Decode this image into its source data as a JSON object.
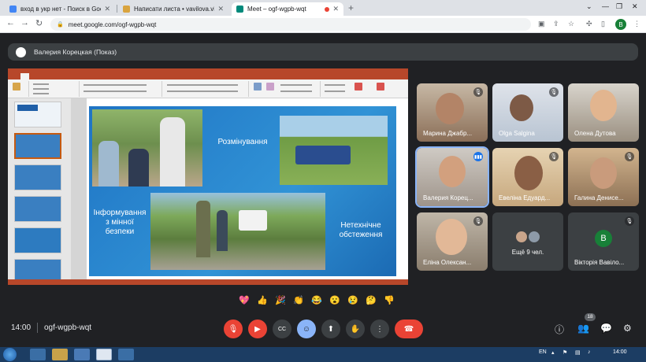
{
  "browser": {
    "tabs": [
      {
        "label": "вход в укр нет - Поиск в Google",
        "favicon_color": "#4285f4"
      },
      {
        "label": "Написати листа • vavilova.viccs...",
        "favicon_color": "#d9a43f"
      },
      {
        "label": "Meet – ogf-wgpb-wqt",
        "favicon_color": "#00897b"
      }
    ],
    "new_tab": "+",
    "url": "meet.google.com/ogf-wgpb-wqt",
    "profile_initial": "В"
  },
  "presenter": {
    "label": "Валерия Корецкая (Показ)"
  },
  "slide": {
    "texts": [
      "Розмінування",
      "Інформування з мінної безпеки",
      "Нетехнічне обстеження"
    ]
  },
  "participants": [
    {
      "name": "Марина Джабр...",
      "state": "muted"
    },
    {
      "name": "Olga Salgina",
      "state": "muted"
    },
    {
      "name": "Олена Дутова",
      "state": "none"
    },
    {
      "name": "Валерия Корец...",
      "state": "speaking"
    },
    {
      "name": "Евеліна Едуард...",
      "state": "muted"
    },
    {
      "name": "Галина Денисе...",
      "state": "muted"
    },
    {
      "name": "Еліна Олексан...",
      "state": "muted"
    },
    {
      "name": "Ещё 9 чел.",
      "state": "none"
    },
    {
      "name": "Вікторія Вавіло...",
      "state": "muted",
      "initial": "В"
    }
  ],
  "reactions": [
    "💖",
    "👍",
    "🎉",
    "👏",
    "😂",
    "😮",
    "😢",
    "🤔",
    "👎"
  ],
  "meeting": {
    "time": "14:00",
    "code": "ogf-wgpb-wqt",
    "participant_count": "18"
  },
  "taskbar": {
    "lang": "EN",
    "clock": "14:00"
  }
}
